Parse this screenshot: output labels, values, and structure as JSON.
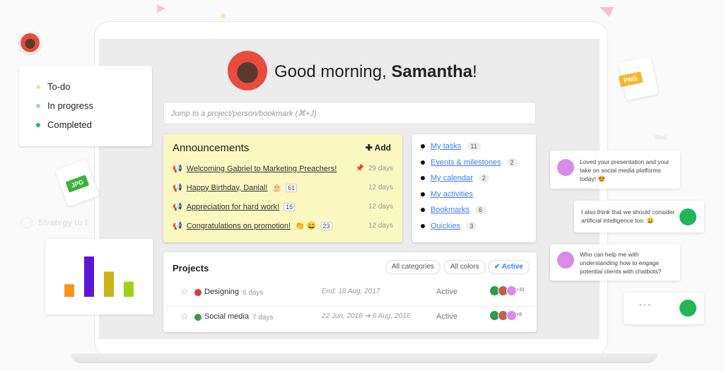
{
  "greeting": {
    "prefix": "Good morning, ",
    "name": "Samantha",
    "suffix": "!"
  },
  "search": {
    "placeholder": "Jump to a project/person/bookmark (⌘+J)"
  },
  "announcements": {
    "title": "Announcements",
    "add_label": "Add",
    "items": [
      {
        "text": "Welcoming Gabriel to Marketing Preachers!",
        "pinned": true,
        "emoji": "",
        "count": "",
        "age": "29 days"
      },
      {
        "text": "Happy Birthday, Danial!",
        "emoji": "🎂",
        "count": "61",
        "age": "12 days"
      },
      {
        "text": "Appreciation for hard work!",
        "emoji": "",
        "count": "15",
        "age": "12 days"
      },
      {
        "text": "Congratulations on promotion!",
        "emoji": "👏 😄",
        "count": "23",
        "age": "12 days"
      }
    ]
  },
  "links": [
    {
      "label": "My tasks",
      "count": "11"
    },
    {
      "label": "Events & milestones",
      "count": "2"
    },
    {
      "label": "My calendar",
      "count": "2"
    },
    {
      "label": "My activities",
      "count": ""
    },
    {
      "label": "Bookmarks",
      "count": "6"
    },
    {
      "label": "Quickies",
      "count": "3"
    }
  ],
  "projects": {
    "title": "Projects",
    "filters": [
      "All categories",
      "All colors",
      "✔ Active"
    ],
    "rows": [
      {
        "name": "Designing",
        "age": "6 days",
        "dates": "End: 18 Aug, 2017",
        "status": "Active",
        "color": "#d93a3a",
        "more": "+31"
      },
      {
        "name": "Social media",
        "age": "7 days",
        "dates": "22 Jun, 2016 ➔ 6 Aug, 2016",
        "status": "Active",
        "color": "#3a9d43",
        "more": "+8"
      }
    ]
  },
  "legend": [
    {
      "label": "To-do",
      "color": "#f7dc9a"
    },
    {
      "label": "In progress",
      "color": "#a9c4f7"
    },
    {
      "label": "Completed",
      "color": "#1fbf60"
    }
  ],
  "faded_task": "Strategy to I",
  "files": {
    "png": "PNG",
    "jpg": "JPG"
  },
  "chat": {
    "day": "Wed",
    "messages": [
      {
        "text": "Loved your presentation and your take on social media platforms today! 😍"
      },
      {
        "text": "I also think that we should consider artificial intelligence too. 😀"
      },
      {
        "text": "Who can help me with understanding how to engage potential clients with chatbots?"
      },
      {
        "text": "• • •"
      }
    ]
  },
  "chart_data": {
    "type": "bar",
    "categories": [
      "",
      "",
      "",
      ""
    ],
    "values": [
      1,
      3.2,
      2,
      1.2
    ],
    "colors": [
      "#f7941d",
      "#5b17d6",
      "#cdb318",
      "#a3d014"
    ],
    "title": "",
    "xlabel": "",
    "ylabel": ""
  }
}
